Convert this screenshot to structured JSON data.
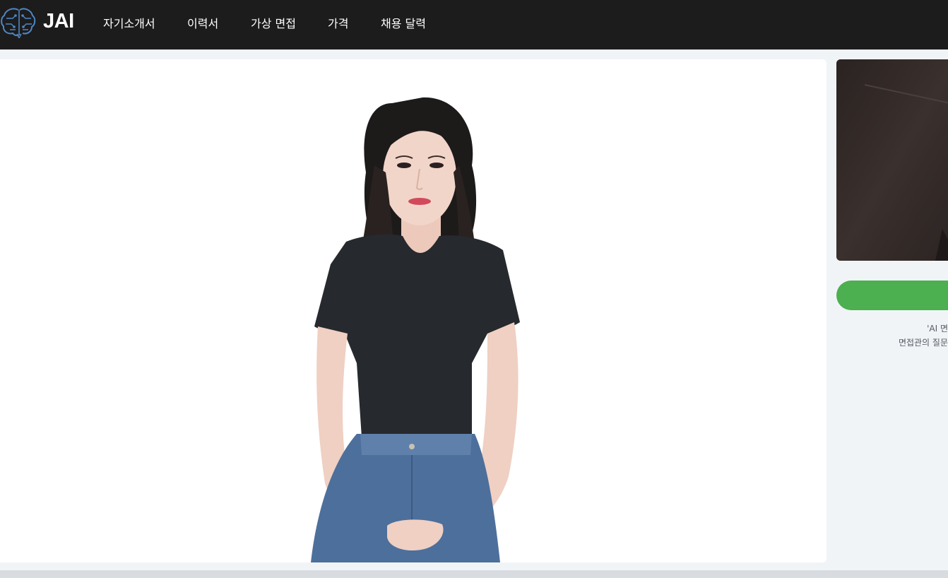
{
  "app": {
    "brand": "JAI",
    "logo_icon": "brain-circuit-icon"
  },
  "nav": {
    "items": [
      {
        "label": "자기소개서"
      },
      {
        "label": "이력서"
      },
      {
        "label": "가상 면접"
      },
      {
        "label": "가격"
      },
      {
        "label": "채용 달력"
      }
    ]
  },
  "interview": {
    "interviewer_video": "avatar-video",
    "user_camera": "webcam-preview",
    "start_button_label": "",
    "help_lines": [
      "'AI 면",
      "면접관의 질문"
    ]
  },
  "colors": {
    "topbar": "#1c1c1c",
    "accent_green": "#4caf50",
    "page_bg": "#f1f4f7"
  }
}
